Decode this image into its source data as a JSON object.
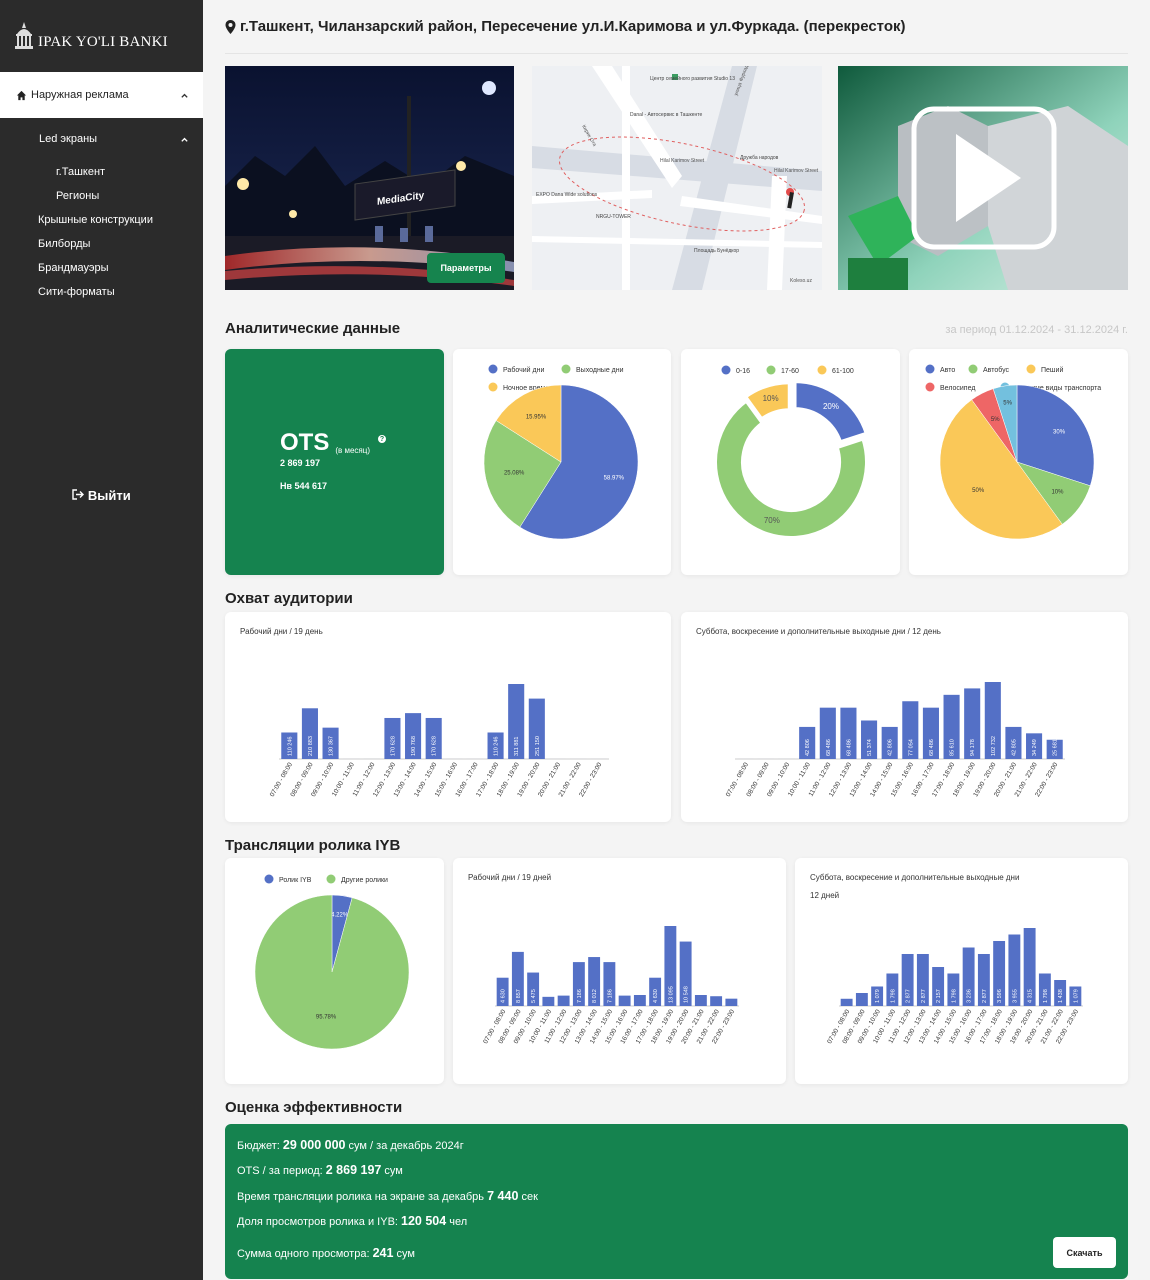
{
  "brand": {
    "name": "IPAK YO'LI BANKI"
  },
  "sidebar": {
    "top": "Наружная реклама",
    "section": "Led экраны",
    "subitems": [
      "г.Ташкент",
      "Регионы"
    ],
    "items": [
      "Крышные конструкции",
      "Билборды",
      "Брандмауэры",
      "Сити-форматы"
    ],
    "logout": "Выйти"
  },
  "address": "г.Ташкент, Чиланзарский район, Пересечение ул.И.Каримова и ул.Фуркада. (перекресток)",
  "media": {
    "photo_sign": "MediaCity",
    "params_button": "Параметры",
    "map_labels": [
      "Центр семейного развития Studio 13",
      "Danal - Автосервис в Ташкенте",
      "Hilal Karimov Street",
      "Дружба народов",
      "Hilal Karimov Street",
      "NRGU-TOWER",
      "Площадь Бунёдкор",
      "EXPO Dana Wide solutions",
      "улица Фуркада",
      "Кирик Ота",
      "Koleso.uz"
    ]
  },
  "analytics": {
    "title": "Аналитические данные",
    "period": "за период 01.12.2024 - 31.12.2024 г.",
    "ots": {
      "label": "OTS",
      "unit": "(в месяц)",
      "value": "2 869 197",
      "nb": "Нв 544 617"
    }
  },
  "reach": {
    "title": "Охват аудитории"
  },
  "broadcast": {
    "title": "Трансляции ролика IYB"
  },
  "effectiveness": {
    "title": "Оценка эффективности",
    "budget_label": "Бюджет:",
    "budget_value": "29 000 000",
    "budget_suffix": "сум / за декабрь 2024г",
    "ots_label": "OTS / за период:",
    "ots_value": "2 869 197",
    "ots_suffix": "сум",
    "time_label": "Время трансляции ролика на экране за декабрь",
    "time_value": "7 440",
    "time_suffix": "сек",
    "share_label": "Доля просмотров ролика и IYB:",
    "share_value": "120 504",
    "share_suffix": "чел",
    "sum_label": "Сумма одного просмотра:",
    "sum_value": "241",
    "sum_suffix": "сум",
    "download": "Скачать"
  },
  "colors": {
    "green": "#15834f",
    "blue": "#5470c6",
    "lightgreen": "#91cc75",
    "yellow": "#fac858",
    "red": "#ee6666",
    "cyan": "#73c0de"
  },
  "chart_data": [
    {
      "type": "pie",
      "legend": [
        "Рабочий дни",
        "Выходные дни",
        "Ночное время"
      ],
      "series": [
        {
          "name": "Рабочий дни",
          "value": 58.97,
          "label": "58.97%"
        },
        {
          "name": "Выходные дни",
          "value": 25.08,
          "label": "25.08%"
        },
        {
          "name": "Ночное время",
          "value": 15.95,
          "label": "15.95%"
        }
      ]
    },
    {
      "type": "pie",
      "legend": [
        "0-16",
        "17-60",
        "61-100"
      ],
      "donut": true,
      "series": [
        {
          "name": "0-16",
          "value": 20,
          "label": "20%"
        },
        {
          "name": "17-60",
          "value": 70,
          "label": "70%"
        },
        {
          "name": "61-100",
          "value": 10,
          "label": "10%"
        }
      ]
    },
    {
      "type": "pie",
      "legend": [
        "Авто",
        "Автобус",
        "Пеший",
        "Велосипед",
        "И другие виды транспорта"
      ],
      "series": [
        {
          "name": "Авто",
          "value": 30,
          "label": "30%"
        },
        {
          "name": "Автобус",
          "value": 10,
          "label": "10%"
        },
        {
          "name": "Пеший",
          "value": 50,
          "label": "50%"
        },
        {
          "name": "Велосипед",
          "value": 5,
          "label": "5%"
        },
        {
          "name": "И другие виды транспорта",
          "value": 5,
          "label": "5%"
        }
      ]
    },
    {
      "type": "bar",
      "title": "Рабочий дни / 19 день",
      "categories": [
        "07:00 - 08:00",
        "08:00 - 09:00",
        "09:00 - 10:00",
        "10:00 - 11:00",
        "11:00 - 12:00",
        "12:00 - 13:00",
        "13:00 - 14:00",
        "14:00 - 15:00",
        "15:00 - 16:00",
        "16:00 - 17:00",
        "17:00 - 18:00",
        "18:00 - 19:00",
        "19:00 - 20:00",
        "20:00 - 21:00",
        "21:00 - 22:00",
        "22:00 - 23:00"
      ],
      "values": [
        110246,
        210883,
        130367,
        45,
        70,
        170628,
        190768,
        170628,
        45,
        45,
        110246,
        311881,
        251150,
        45,
        45,
        35
      ],
      "labels": [
        "110 246",
        "210 883",
        "130 367",
        "",
        "",
        "170 628",
        "190 768",
        "170 628",
        "",
        "",
        "110 246",
        "311 881",
        "251 150",
        "",
        "",
        ""
      ]
    },
    {
      "type": "bar",
      "title": "Суббота, воскресение и дополнительные выходные дни / 12 день",
      "categories": [
        "07:00 - 08:00",
        "08:00 - 09:00",
        "09:00 - 10:00",
        "10:00 - 11:00",
        "11:00 - 12:00",
        "12:00 - 13:00",
        "13:00 - 14:00",
        "14:00 - 15:00",
        "15:00 - 16:00",
        "16:00 - 17:00",
        "17:00 - 18:00",
        "18:00 - 19:00",
        "19:00 - 20:00",
        "20:00 - 21:00",
        "21:00 - 22:00",
        "22:00 - 23:00"
      ],
      "values": [
        10,
        20,
        28,
        42806,
        68486,
        68486,
        51374,
        42806,
        77054,
        68486,
        85610,
        94178,
        102732,
        42806,
        34249,
        25681
      ],
      "labels": [
        "",
        "",
        "",
        "42 806",
        "68 486",
        "68 486",
        "51 374",
        "42 806",
        "77 054",
        "68 486",
        "85 610",
        "94 178",
        "102 732",
        "42 805",
        "34 249",
        "25 681"
      ]
    },
    {
      "type": "pie",
      "legend": [
        "Ролик IYB",
        "Другие ролики"
      ],
      "series": [
        {
          "name": "Ролик IYB",
          "value": 4.22,
          "label": "4.22%"
        },
        {
          "name": "Другие ролики",
          "value": 95.78,
          "label": "95.78%"
        }
      ]
    },
    {
      "type": "bar",
      "title": "Рабочий дни / 19 дней",
      "categories": [
        "07:00 - 08:00",
        "08:00 - 09:00",
        "09:00 - 10:00",
        "10:00 - 11:00",
        "11:00 - 12:00",
        "12:00 - 13:00",
        "13:00 - 14:00",
        "14:00 - 15:00",
        "15:00 - 16:00",
        "16:00 - 17:00",
        "17:00 - 18:00",
        "18:00 - 19:00",
        "19:00 - 20:00",
        "20:00 - 21:00",
        "21:00 - 22:00",
        "22:00 - 23:00"
      ],
      "values": [
        4630,
        8857,
        5475,
        1500,
        1700,
        7186,
        8012,
        7186,
        1700,
        1800,
        4630,
        13095,
        10548,
        1800,
        1600,
        1200
      ],
      "labels": [
        "4 630",
        "8 857",
        "5 475",
        "",
        "",
        "7 186",
        "8 012",
        "7 186",
        "",
        "",
        "4 630",
        "13 095",
        "10 548",
        "",
        "",
        ""
      ]
    },
    {
      "type": "bar",
      "title": "Суббота, воскресение и дополнительные выходные дни",
      "subtitle": "12 дней",
      "categories": [
        "07:00 - 08:00",
        "08:00 - 09:00",
        "09:00 - 10:00",
        "10:00 - 11:00",
        "11:00 - 12:00",
        "12:00 - 13:00",
        "13:00 - 14:00",
        "14:00 - 15:00",
        "15:00 - 16:00",
        "16:00 - 17:00",
        "17:00 - 18:00",
        "18:00 - 19:00",
        "19:00 - 20:00",
        "20:00 - 21:00",
        "21:00 - 22:00",
        "22:00 - 23:00"
      ],
      "values": [
        400,
        719,
        1079,
        1798,
        2877,
        2877,
        2157,
        1798,
        3236,
        2877,
        3596,
        3955,
        4315,
        1798,
        1438,
        1079
      ],
      "labels": [
        "",
        "",
        "1 079",
        "1 798",
        "2 877",
        "2 877",
        "2 157",
        "1 798",
        "3 236",
        "2 877",
        "3 596",
        "3 955",
        "4 315",
        "1 798",
        "1 438",
        "1 079"
      ]
    }
  ]
}
